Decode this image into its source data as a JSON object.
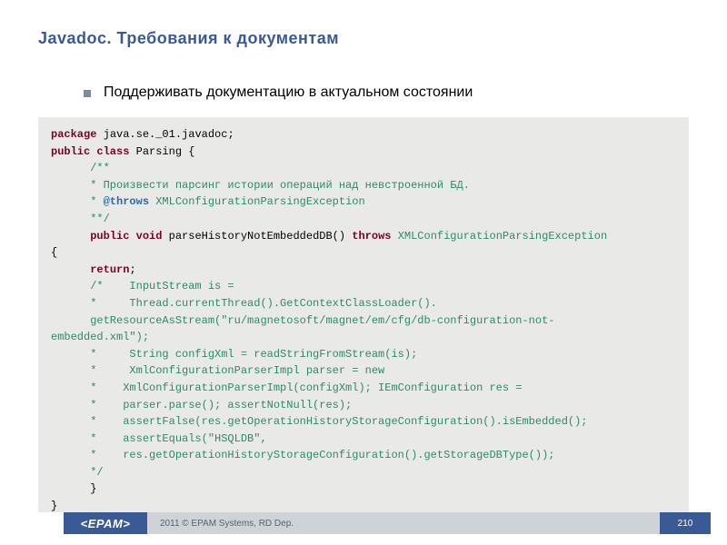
{
  "title": "Javadoc. Требования к документам",
  "bullet": "Поддерживать документацию в актуальном состоянии",
  "code": {
    "l01a": "package",
    "l01b": " java.se._01.javadoc;",
    "l02a": "public class",
    "l02b": " Parsing {",
    "l03": "      /**",
    "l04": "      * Произвести парсинг истории операций над невстроенной БД.",
    "l05a": "      * ",
    "l05b": "@throws",
    "l05c": " XMLConfigurationParsingException",
    "l06": "      **/",
    "l07a": "      ",
    "l07b": "public void",
    "l07c": " parseHistoryNotEmbeddedDB() ",
    "l07d": "throws",
    "l07e": " XMLConfigurationParsingException",
    "l08": "{",
    "l09a": "      ",
    "l09b": "return",
    "l10": "      /*    InputStream is =",
    "l11": "      *     Thread.currentThread().GetContextClassLoader().",
    "l12": "      getResourceAsStream(\"ru/magnetosoft/magnet/em/cfg/db-configuration-not-",
    "l13": "embedded.xml\");",
    "l14": "      *     String configXml = readStringFromStream(is);",
    "l15": "      *     XmlConfigurationParserImpl parser = new",
    "l16": "      *    XmlConfigurationParserImpl(configXml); IEmConfiguration res =",
    "l17": "      *    parser.parse(); assertNotNull(res);",
    "l18": "      *    assertFalse(res.getOperationHistoryStorageConfiguration().isEmbedded();",
    "l19": "      *    assertEquals(\"HSQLDB\",",
    "l20": "      *    res.getOperationHistoryStorageConfiguration().getStorageDBType());",
    "l21": "      */",
    "l22": "      }",
    "l23": "}"
  },
  "footer": {
    "logo": "<EPAM>",
    "copyright": "2011 © EPAM Systems, RD Dep.",
    "page": "210"
  }
}
